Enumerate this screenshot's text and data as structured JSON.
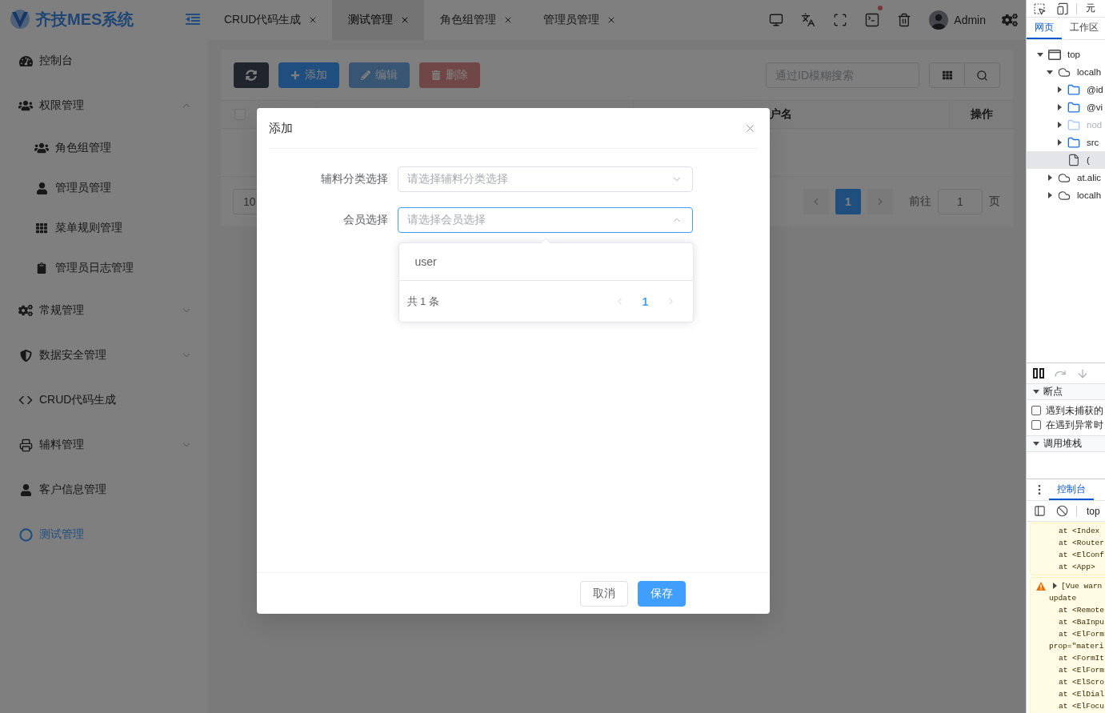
{
  "sidebar": {
    "logo": "齐技MES系统",
    "menu": [
      {
        "label": "控制台",
        "selected": false
      },
      {
        "label": "权限管理",
        "selected": false,
        "expanded": true,
        "children": [
          {
            "label": "角色组管理",
            "selected": false
          },
          {
            "label": "管理员管理",
            "selected": false
          },
          {
            "label": "菜单规则管理",
            "selected": false
          },
          {
            "label": "管理员日志管理",
            "selected": false
          }
        ]
      },
      {
        "label": "常规管理",
        "selected": false,
        "expanded": false
      },
      {
        "label": "数据安全管理",
        "selected": false,
        "expanded": false
      },
      {
        "label": "CRUD代码生成",
        "selected": false
      },
      {
        "label": "辅料管理",
        "selected": false,
        "expanded": false
      },
      {
        "label": "客户信息管理",
        "selected": false
      },
      {
        "label": "测试管理",
        "selected": true
      }
    ]
  },
  "nav_tabs": [
    {
      "label": "CRUD代码生成",
      "selected": false
    },
    {
      "label": "测试管理",
      "selected": true
    },
    {
      "label": "角色组管理",
      "selected": false
    },
    {
      "label": "管理员管理",
      "selected": false
    }
  ],
  "header": {
    "user": "Admin"
  },
  "toolbar": {
    "buttons": [
      {
        "kind": "dark",
        "disabled": false
      },
      {
        "kind": "primary",
        "label": "添加",
        "disabled": false
      },
      {
        "kind": "primary",
        "label": "编辑",
        "disabled": true
      },
      {
        "kind": "danger",
        "label": "删除",
        "disabled": true
      }
    ],
    "search": {
      "placeholder": "通过ID模糊搜索"
    }
  },
  "table": {
    "select_all": {
      "checked": false
    },
    "columns": [
      {
        "label": "户名"
      },
      {
        "label": "操作"
      }
    ]
  },
  "pagination": {
    "page_size": "10",
    "pages": [
      {
        "label": "1",
        "selected": true
      }
    ],
    "goto_label": "前往",
    "goto_value": "1",
    "goto_suffix": "页"
  },
  "dialog": {
    "title": "添加",
    "fields": [
      {
        "label": "辅料分类选择",
        "placeholder": "请选择辅料分类选择",
        "expanded": false
      },
      {
        "label": "会员选择",
        "placeholder": "请选择会员选择",
        "expanded": true
      }
    ],
    "dropdown": {
      "options": [
        {
          "label": "user",
          "selected": false
        }
      ],
      "total": "共 1 条",
      "pages": [
        {
          "label": "1",
          "selected": true
        }
      ]
    },
    "buttons": [
      {
        "kind": "default",
        "label": "取消"
      },
      {
        "kind": "primary",
        "label": "保存"
      }
    ]
  },
  "devtools": {
    "panel_tab": "元",
    "tabs": [
      {
        "label": "网页",
        "selected": true
      },
      {
        "label": "工作区",
        "selected": false
      }
    ],
    "tree": [
      {
        "label": "top",
        "kind": "frame",
        "selected": false,
        "disabled": false,
        "expanded": true,
        "children": [
          {
            "label": "localh",
            "kind": "origin",
            "selected": false,
            "disabled": false,
            "expanded": true,
            "children": [
              {
                "label": "@id",
                "kind": "folder",
                "selected": false,
                "disabled": false,
                "expanded": false
              },
              {
                "label": "@vi",
                "kind": "folder",
                "selected": false,
                "disabled": false,
                "expanded": false
              },
              {
                "label": "nod",
                "kind": "folder",
                "selected": false,
                "disabled": true,
                "expanded": false
              },
              {
                "label": "src",
                "kind": "folder",
                "selected": false,
                "disabled": false,
                "expanded": false
              },
              {
                "label": "(",
                "kind": "file",
                "selected": true,
                "disabled": false
              }
            ]
          },
          {
            "label": "at.alic",
            "kind": "origin",
            "selected": false,
            "disabled": false,
            "expanded": false
          },
          {
            "label": "localh",
            "kind": "origin",
            "selected": false,
            "disabled": false,
            "expanded": false
          }
        ]
      }
    ],
    "sections": [
      {
        "label": "断点",
        "expanded": true,
        "checkboxes": [
          {
            "label": "遇到未捕获的",
            "checked": false
          },
          {
            "label": "在遇到异常时",
            "checked": false
          }
        ]
      },
      {
        "label": "调用堆栈",
        "expanded": true
      }
    ],
    "drawer_tabs": [
      {
        "label": "控制台",
        "selected": true
      }
    ],
    "console_context": "top",
    "messages": [
      {
        "kind": "continuation",
        "lines": [
          {
            "kind": "frame",
            "text": "at <Index"
          },
          {
            "kind": "frame",
            "text": "at <Router"
          },
          {
            "kind": "frame",
            "text": "at <ElConf"
          },
          {
            "kind": "frame",
            "text": "at <App>"
          }
        ]
      },
      {
        "kind": "warning",
        "expanded": false,
        "head": "[Vue warn",
        "lines": [
          {
            "kind": "wrap",
            "text": "update"
          },
          {
            "kind": "frame",
            "text": "at <Remote"
          },
          {
            "kind": "frame",
            "text": "at <BaInpu"
          },
          {
            "kind": "frame",
            "text": "at <ElForm"
          },
          {
            "kind": "wrap",
            "text": "prop=\"materi"
          },
          {
            "kind": "frame",
            "text": "at <FormIt"
          },
          {
            "kind": "frame",
            "text": "at <ElForm"
          },
          {
            "kind": "frame",
            "text": "at <ElScro"
          },
          {
            "kind": "frame",
            "text": "at <ElDial"
          },
          {
            "kind": "frame",
            "text": "at <ElFocu"
          }
        ]
      }
    ]
  }
}
